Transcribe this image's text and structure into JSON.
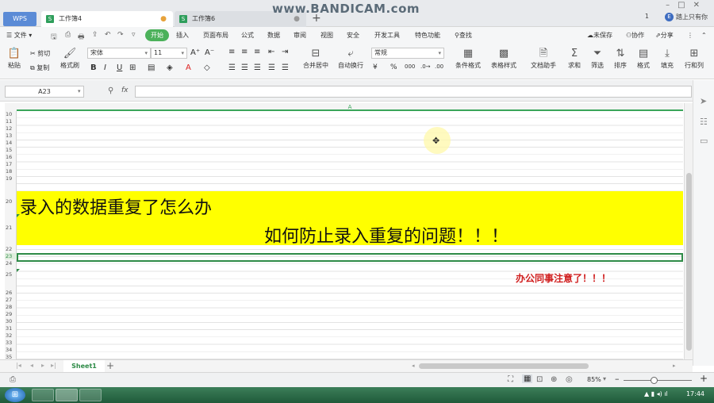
{
  "window": {
    "app_button": "WPS",
    "tabs": [
      {
        "label": "工作簿4",
        "active": true
      },
      {
        "label": "工作簿6",
        "active": false
      }
    ],
    "add_tab": "+",
    "watermark": "www.BANDICAM.com",
    "login_text": "踏上只有你",
    "login_avatar": "E",
    "counter": "1"
  },
  "menu": {
    "file": "文件",
    "start": "开始",
    "items": [
      "插入",
      "页面布局",
      "公式",
      "数据",
      "审阅",
      "视图",
      "安全",
      "开发工具",
      "特色功能"
    ],
    "search": "查找",
    "unsaved": "未保存",
    "collab": "协作",
    "share": "分享"
  },
  "toolbar": {
    "cut": "剪切",
    "copy": "复制",
    "paste": "粘贴",
    "format_painter": "格式刷",
    "font_name": "宋体",
    "font_size": "11",
    "merge_center": "合并居中",
    "auto_wrap": "自动换行",
    "number_format": "常规",
    "conditional_format": "条件格式",
    "table_style": "表格样式",
    "doc_helper": "文档助手",
    "sum": "求和",
    "filter": "筛选",
    "sort": "排序",
    "format": "格式",
    "fill": "填充",
    "row_col": "行和列"
  },
  "formula": {
    "name_box": "A23",
    "fx": "fx",
    "value": ""
  },
  "sheet": {
    "column_header": "A",
    "row_numbers": [
      "10",
      "11",
      "12",
      "13",
      "14",
      "15",
      "16",
      "17",
      "18",
      "19",
      "20",
      "21",
      "22",
      "23",
      "24",
      "25",
      "26",
      "27",
      "28",
      "29",
      "30",
      "31",
      "32",
      "33",
      "34",
      "35"
    ],
    "line1": "录入的数据重复了怎么办",
    "line2": "如何防止录入重复的问题！！！",
    "note": "办公同事注意了！！！",
    "highlight_color": "#ffff00",
    "note_color": "#d01e1e"
  },
  "sheet_tabs": {
    "sheet1": "Sheet1",
    "add": "+"
  },
  "status": {
    "zoom": "85%",
    "zoom_minus": "–",
    "zoom_plus": "+"
  },
  "taskbar": {
    "clock": "17:44"
  }
}
